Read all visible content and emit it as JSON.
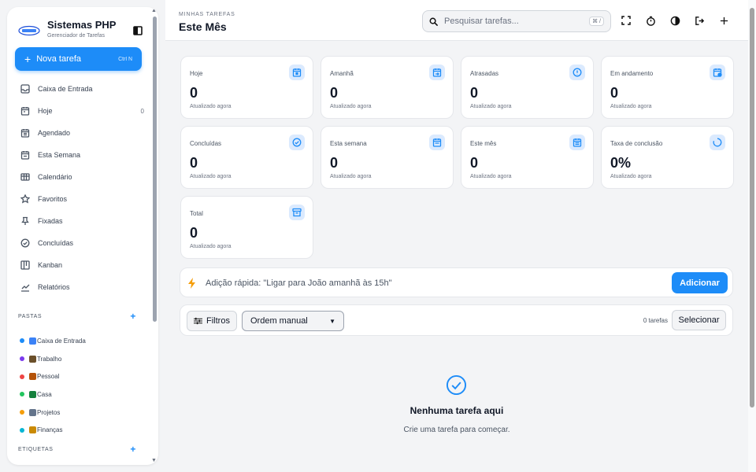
{
  "app": {
    "name": "Sistemas PHP",
    "subtitle": "Gerenciador de Tarefas"
  },
  "new_task": {
    "label": "Nova tarefa",
    "shortcut": "Ctrl N"
  },
  "nav": [
    {
      "label": "Caixa de Entrada",
      "icon": "inbox-icon",
      "count": ""
    },
    {
      "label": "Hoje",
      "icon": "calendar-day-icon",
      "count": "0"
    },
    {
      "label": "Agendado",
      "icon": "calendar-clock-icon",
      "count": ""
    },
    {
      "label": "Esta Semana",
      "icon": "calendar-week-icon",
      "count": ""
    },
    {
      "label": "Calendário",
      "icon": "grid-calendar-icon",
      "count": ""
    },
    {
      "label": "Favoritos",
      "icon": "star-icon",
      "count": ""
    },
    {
      "label": "Fixadas",
      "icon": "pin-icon",
      "count": ""
    },
    {
      "label": "Concluídas",
      "icon": "check-circle-icon",
      "count": ""
    },
    {
      "label": "Kanban",
      "icon": "kanban-icon",
      "count": ""
    },
    {
      "label": "Relatórios",
      "icon": "chart-icon",
      "count": ""
    }
  ],
  "folders_section": {
    "title": "PASTAS"
  },
  "folders": [
    {
      "label": "Caixa de Entrada",
      "dot": "#1d8cf8",
      "emoji_color": "#3b82f6"
    },
    {
      "label": "Trabalho",
      "dot": "#7c3aed",
      "emoji_color": "#6b4f2a"
    },
    {
      "label": "Pessoal",
      "dot": "#ef4444",
      "emoji_color": "#b45309"
    },
    {
      "label": "Casa",
      "dot": "#22c55e",
      "emoji_color": "#15803d"
    },
    {
      "label": "Projetos",
      "dot": "#f59e0b",
      "emoji_color": "#64748b"
    },
    {
      "label": "Finanças",
      "dot": "#06b6d4",
      "emoji_color": "#ca8a04"
    }
  ],
  "tags_section": {
    "title": "ETIQUETAS"
  },
  "header": {
    "kicker": "MINHAS TAREFAS",
    "title": "Este Mês",
    "search_placeholder": "Pesquisar tarefas...",
    "search_shortcut": "⌘ /"
  },
  "stats": [
    {
      "label": "Hoje",
      "value": "0",
      "updated": "Atualizado agora",
      "icon": "calendar-icon"
    },
    {
      "label": "Amanhã",
      "value": "0",
      "updated": "Atualizado agora",
      "icon": "calendar-arrow-icon"
    },
    {
      "label": "Atrasadas",
      "value": "0",
      "updated": "Atualizado agora",
      "icon": "alert-icon"
    },
    {
      "label": "Em andamento",
      "value": "0",
      "updated": "Atualizado agora",
      "icon": "calendar-progress-icon"
    },
    {
      "label": "Concluídas",
      "value": "0",
      "updated": "Atualizado agora",
      "icon": "check-icon"
    },
    {
      "label": "Esta semana",
      "value": "0",
      "updated": "Atualizado agora",
      "icon": "calendar-week-icon"
    },
    {
      "label": "Este mês",
      "value": "0",
      "updated": "Atualizado agora",
      "icon": "calendar-month-icon"
    },
    {
      "label": "Taxa de conclusão",
      "value": "0%",
      "updated": "Atualizado agora",
      "icon": "progress-ring-icon"
    },
    {
      "label": "Total",
      "value": "0",
      "updated": "Atualizado agora",
      "icon": "archive-icon"
    }
  ],
  "quick_add": {
    "placeholder": "Adição rápida: \"Ligar para João amanhã às 15h\"",
    "button": "Adicionar"
  },
  "filter_bar": {
    "filters_label": "Filtros",
    "order_value": "Ordem manual",
    "count": "0 tarefas",
    "select_label": "Selecionar"
  },
  "empty": {
    "title": "Nenhuma tarefa aqui",
    "subtitle": "Crie uma tarefa para começar."
  },
  "colors": {
    "accent": "#1d8cf8",
    "icon_bg": "#dbeafe"
  }
}
